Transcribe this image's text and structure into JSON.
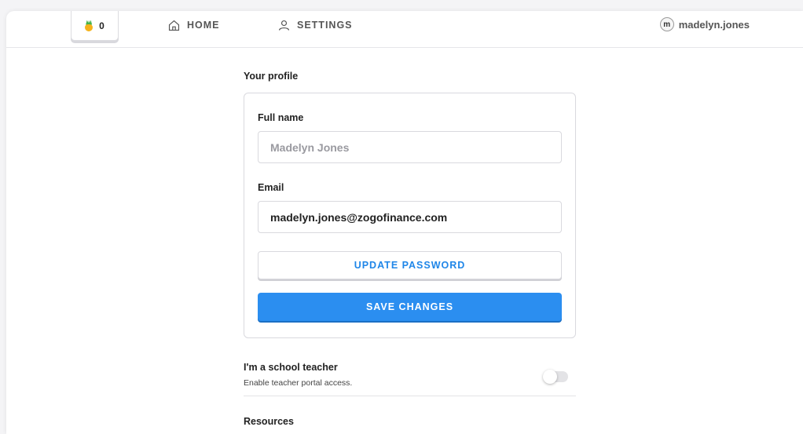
{
  "topbar": {
    "coin_count": "0",
    "nav": [
      {
        "label": "HOME",
        "icon": "home-icon"
      },
      {
        "label": "SETTINGS",
        "icon": "person-icon"
      }
    ],
    "user": {
      "avatar_letter": "m",
      "username": "madelyn.jones"
    }
  },
  "profile": {
    "section_title": "Your profile",
    "full_name_label": "Full name",
    "full_name_placeholder": "Madelyn Jones",
    "email_label": "Email",
    "email_value": "madelyn.jones@zogofinance.com",
    "update_password_label": "UPDATE PASSWORD",
    "save_label": "SAVE CHANGES"
  },
  "teacher": {
    "title": "I'm a school teacher",
    "subtitle": "Enable teacher portal access.",
    "enabled": false
  },
  "resources": {
    "title": "Resources"
  },
  "colors": {
    "accent": "#2b8ef0",
    "link": "#1f86e8",
    "pineapple_body": "#f5b21a",
    "pineapple_leaf": "#46b34a"
  }
}
